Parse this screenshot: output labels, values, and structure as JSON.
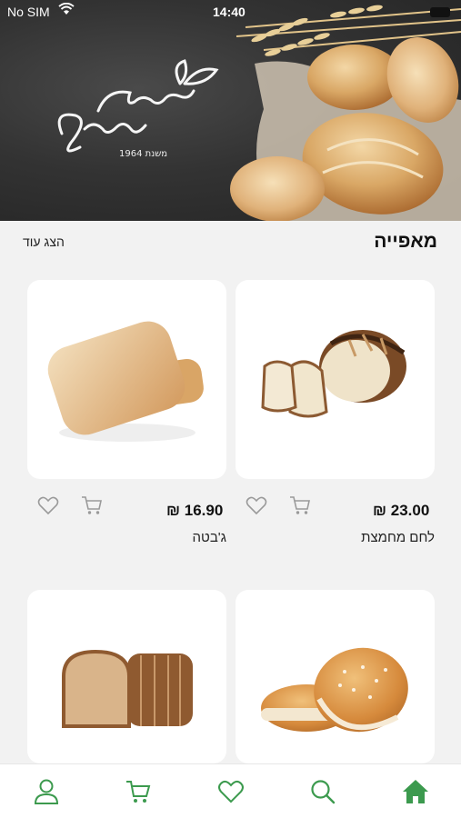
{
  "status_bar": {
    "carrier": "No SIM",
    "time": "14:40"
  },
  "banner": {
    "logo_tagline": "משנת 1964"
  },
  "section": {
    "title": "מאפייה",
    "show_more": "הצג עוד"
  },
  "products": [
    {
      "name": "לחם מחמצת",
      "price": "23.00 ₪"
    },
    {
      "name": "ג'בטה",
      "price": "16.90 ₪"
    },
    {
      "name": "",
      "price": ""
    },
    {
      "name": "",
      "price": ""
    }
  ],
  "tabs": [
    "home-icon",
    "search-icon",
    "heart-icon",
    "cart-icon",
    "profile-icon"
  ],
  "colors": {
    "accent": "#3c9a4e",
    "icon_gray": "#9a9a9a",
    "background": "#f2f2f2"
  }
}
